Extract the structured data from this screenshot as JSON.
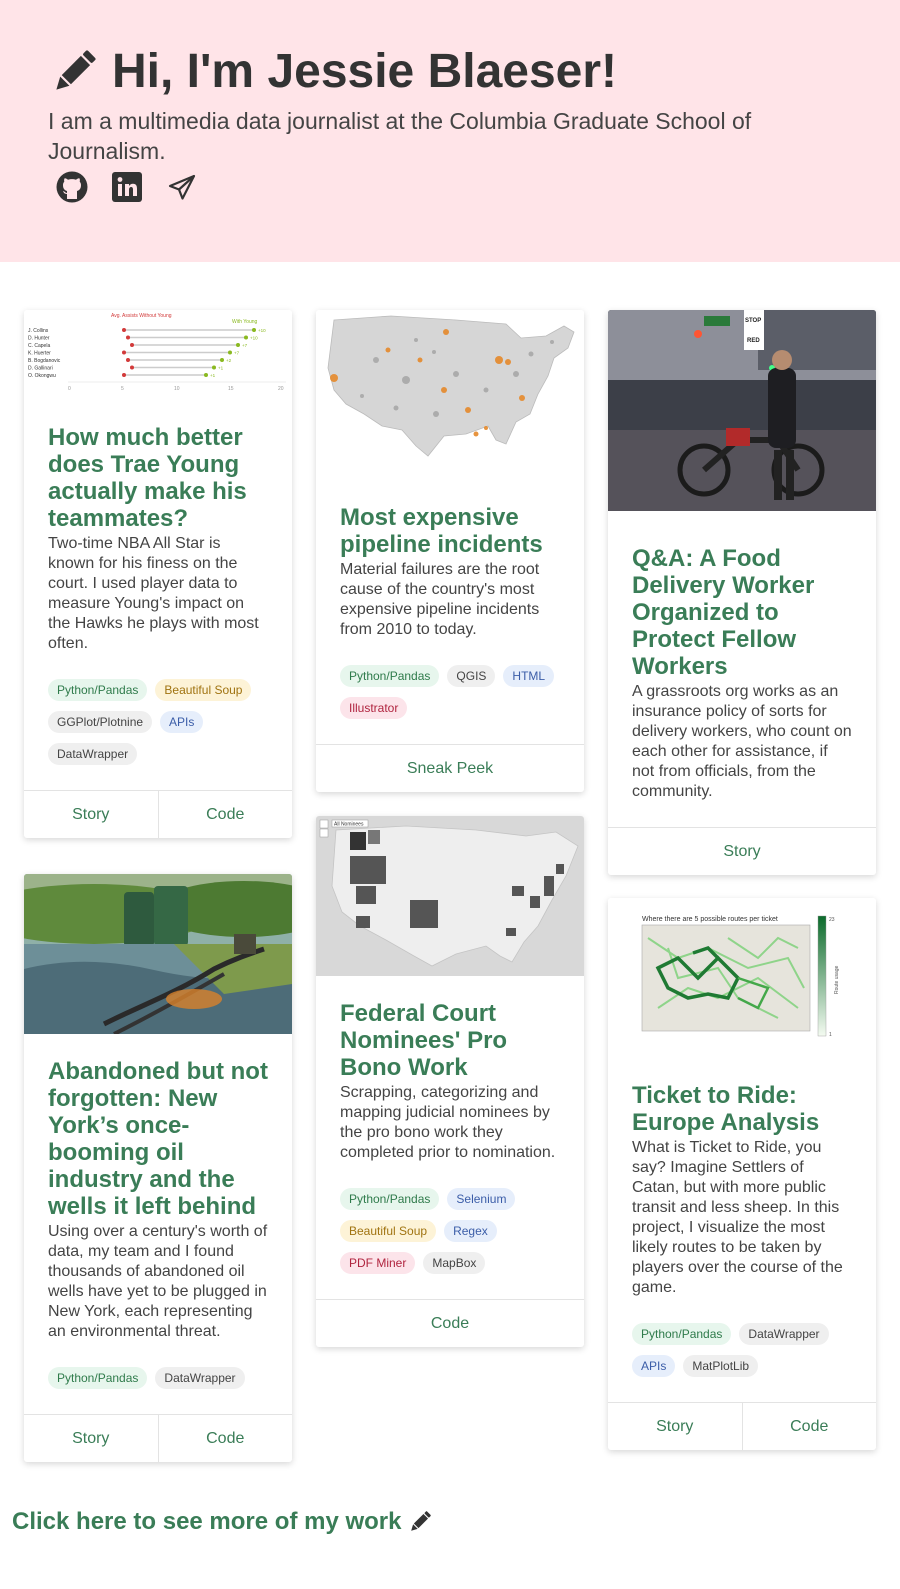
{
  "header": {
    "title": "Hi, I'm Jessie Blaeser!",
    "subtitle": "I am a multimedia data journalist at the Columbia Graduate School of Journalism.",
    "title_icon": "pencil-icon",
    "social_icons": [
      "github-icon",
      "linkedin-icon",
      "paper-plane-icon"
    ]
  },
  "cards": {
    "trae": {
      "title": "How much better does Trae Young actually make his teammates?",
      "description": "Two-time NBA All Star is known for his finess on the court. I used player data to measure Young's impact on the Hawks he plays with most often.",
      "tags": [
        "Python/Pandas",
        "Beautiful Soup",
        "GGPlot/Plotnine",
        "APIs",
        "DataWrapper"
      ],
      "buttons": [
        "Story",
        "Code"
      ],
      "thumb": {
        "legend_left": "Avg. Assists Without Young",
        "legend_right": "With Young",
        "players": [
          "J. Collins",
          "D. Hunter",
          "C. Capela",
          "K. Huerter",
          "B. Bogdanovic",
          "D. Gallinari",
          "O. Okongwu"
        ],
        "deltas": [
          "+10",
          "+10",
          "+7",
          "+7",
          "+2",
          "+1",
          "+1"
        ],
        "ticks": [
          "0",
          "5",
          "10",
          "15",
          "20"
        ]
      }
    },
    "pipeline": {
      "title": "Most expensive pipeline incidents",
      "description": "Material failures are the root cause of the country's most expensive pipeline incidents from 2010 to today.",
      "tags": [
        "Python/Pandas",
        "QGIS",
        "HTML",
        "Illustrator"
      ],
      "buttons": [
        "Sneak Peek"
      ]
    },
    "food": {
      "title": "Q&A: A Food Delivery Worker Organized to Protect Fellow Workers",
      "description": "A grassroots org works as an insurance policy of sorts for delivery workers, who count on each other for assistance, if not from officials, from the community.",
      "buttons": [
        "Story"
      ],
      "thumb": {
        "sign_top": "STOP",
        "sign_bottom": "RED"
      }
    },
    "oil": {
      "title": "Abandoned but not forgotten: New York’s once-booming oil industry and the wells it left behind",
      "description": "Using over a century's worth of data, my team and I found thousands of abandoned oil wells have yet to be plugged in New York, each representing an environmental threat.",
      "tags": [
        "Python/Pandas",
        "DataWrapper"
      ],
      "buttons": [
        "Story",
        "Code"
      ]
    },
    "court": {
      "title": "Federal Court Nominees' Pro Bono Work",
      "description": "Scrapping, categorizing and mapping judicial nominees by the pro bono work they completed prior to nomination.",
      "tags": [
        "Python/Pandas",
        "Selenium",
        "Beautiful Soup",
        "Regex",
        "PDF Miner",
        "MapBox"
      ],
      "buttons": [
        "Code"
      ],
      "thumb": {
        "select_label": "All Nominees"
      }
    },
    "ticket": {
      "title": "Ticket to Ride: Europe Analysis",
      "description": "What is Ticket to Ride, you say? Imagine Settlers of Catan, but with more public transit and less sheep. In this project, I visualize the most likely routes to be taken by players over the course of the game.",
      "tags": [
        "Python/Pandas",
        "DataWrapper",
        "APIs",
        "MatPlotLib"
      ],
      "buttons": [
        "Story",
        "Code"
      ],
      "thumb": {
        "chart_title": "Where there are 5 possible routes per ticket",
        "bar_label": "Route usage",
        "bar_max": "23",
        "bar_min": "1"
      }
    }
  },
  "tag_styles": {
    "Python/Pandas": "t-green",
    "Beautiful Soup": "t-yellow",
    "GGPlot/Plotnine": "t-gray",
    "APIs": "t-blue",
    "DataWrapper": "t-gray",
    "QGIS": "t-gray",
    "HTML": "t-blue",
    "Illustrator": "t-pink",
    "Selenium": "t-blue",
    "Regex": "t-blue",
    "PDF Miner": "t-pink",
    "MapBox": "t-gray",
    "MatPlotLib": "t-gray"
  },
  "footer": {
    "more_link": "Click here to see more of my work"
  },
  "colors": {
    "hero_bg": "#ffe4e8",
    "accent": "#3a7d57",
    "text": "#333333"
  }
}
